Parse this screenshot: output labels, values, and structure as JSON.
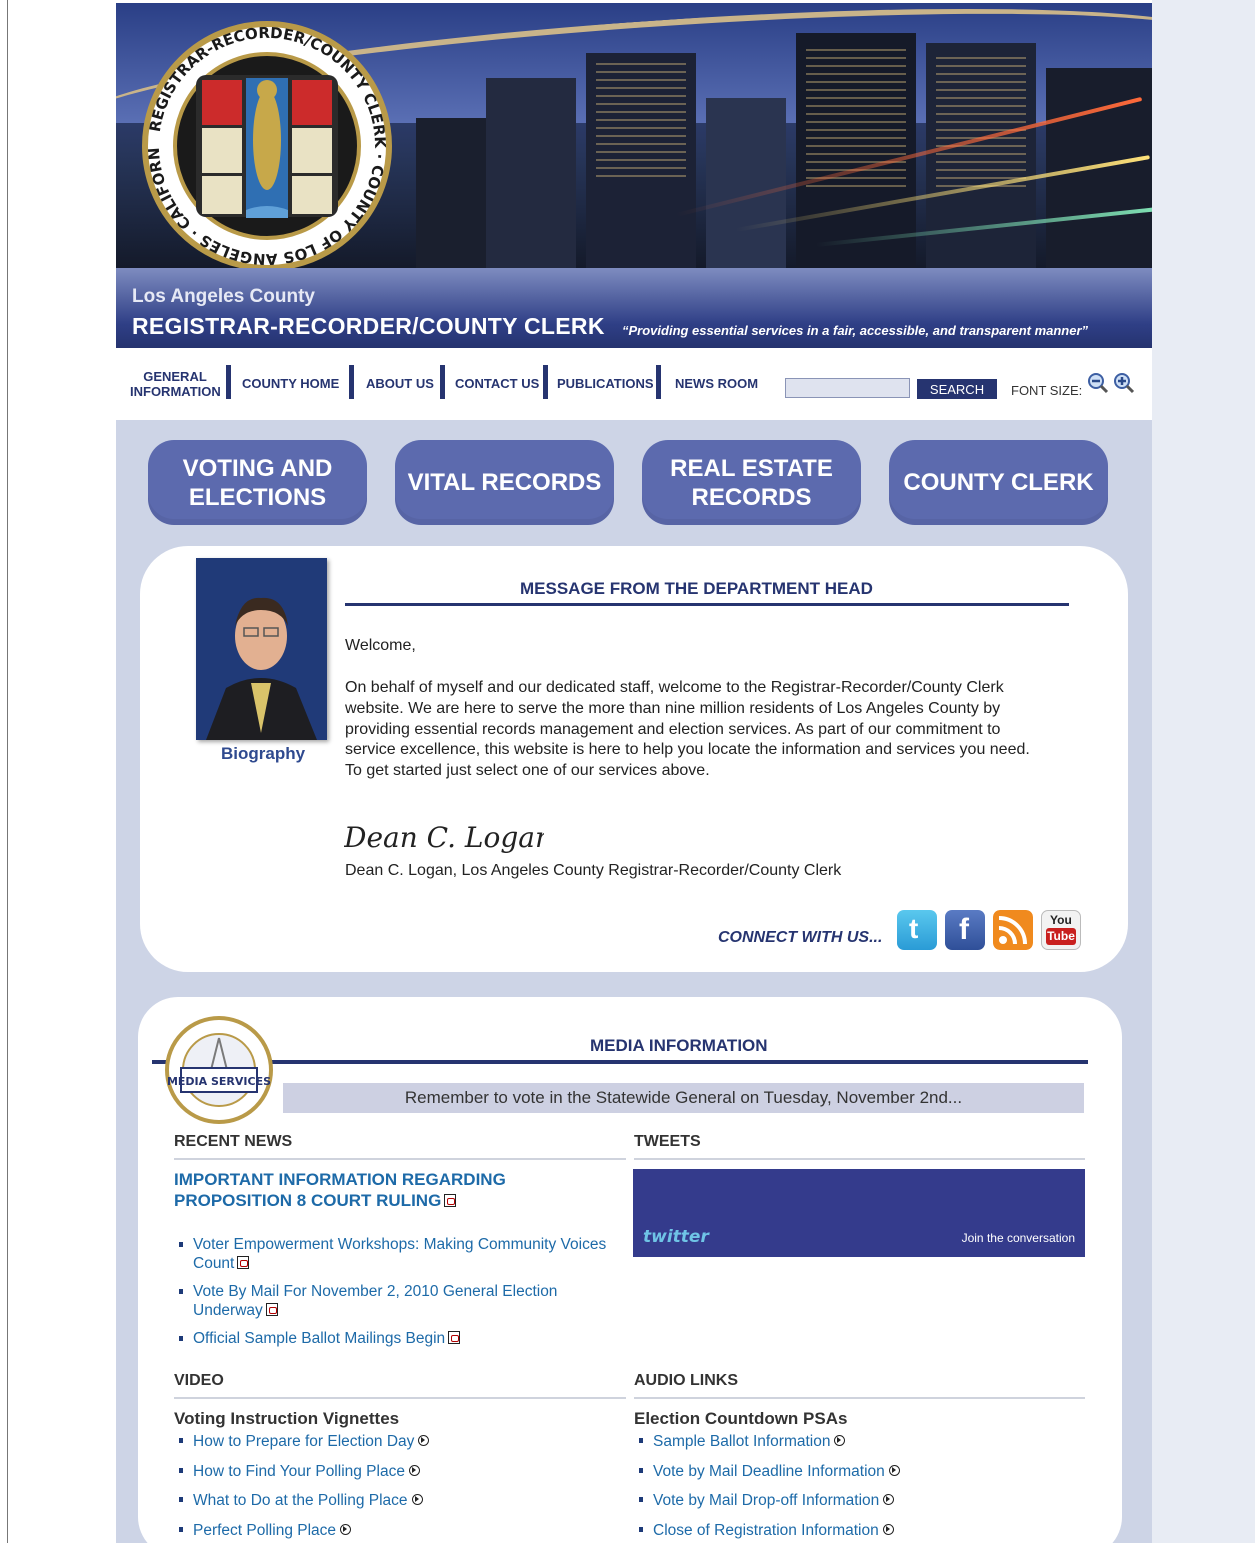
{
  "header": {
    "county": "Los Angeles County",
    "department": "REGISTRAR-RECORDER/COUNTY CLERK",
    "tagline": "“Providing essential services in a fair, accessible, and transparent manner”",
    "seal_text": "REGISTRAR-RECORDER/COUNTY CLERK · COUNTY OF LOS ANGELES · CALIFORNIA"
  },
  "nav": {
    "general_information": "GENERAL INFORMATION",
    "county_home": "COUNTY HOME",
    "about_us": "ABOUT US",
    "contact_us": "CONTACT US",
    "publications": "PUBLICATIONS",
    "news_room": "NEWS ROOM",
    "search_value": "",
    "search_button": "SEARCH",
    "font_size_label": "FONT SIZE:"
  },
  "services": [
    "VOTING AND ELECTIONS",
    "VITAL RECORDS",
    "REAL ESTATE RECORDS",
    "COUNTY CLERK"
  ],
  "message": {
    "heading": "MESSAGE FROM THE DEPARTMENT HEAD",
    "bio_link": "Biography",
    "greeting": "Welcome,",
    "body": "On behalf of myself and our dedicated staff, welcome to the Registrar-Recorder/County Clerk website. We are here to serve the more than nine million residents of Los Angeles County by providing essential records management and election services. As part of our commitment to service excellence, this website is here to help you locate the information and services you need. To get started just select one of our services above.",
    "signature": "Dean C. Logan",
    "signer": "Dean C. Logan, Los Angeles County Registrar-Recorder/County Clerk",
    "connect": "CONNECT WITH US..."
  },
  "social": {
    "twitter": "t",
    "facebook": "f",
    "youtube_top": "You",
    "youtube_bottom": "Tube"
  },
  "media": {
    "heading": "MEDIA INFORMATION",
    "seal_label": "MEDIA SERVICES",
    "ticker": "Remember to vote in the Statewide General on Tuesday, November 2nd...",
    "recent_news_heading": "RECENT NEWS",
    "headline": "IMPORTANT INFORMATION REGARDING PROPOSITION 8 COURT RULING",
    "news": [
      "Voter Empowerment Workshops: Making Community Voices Count",
      "Vote By Mail For November 2, 2010 General Election Underway",
      "Official Sample Ballot Mailings Begin"
    ],
    "tweets_heading": "TWEETS",
    "twitter_logo": "twitter",
    "twitter_join": "Join the conversation",
    "video_heading": "VIDEO",
    "video_subheading": "Voting Instruction Vignettes",
    "videos": [
      "How to Prepare for Election Day",
      "How to Find Your Polling Place",
      "What to Do at the Polling Place",
      "Perfect Polling Place"
    ],
    "audio_heading": "AUDIO LINKS",
    "audio_subheading": "Election Countdown PSAs",
    "audio": [
      "Sample Ballot Information",
      "Vote by Mail Deadline Information",
      "Vote by Mail Drop-off Information",
      "Close of Registration Information"
    ]
  },
  "colors": {
    "navy": "#263470",
    "service_button": "#5c6aae",
    "link": "#1d6aa8",
    "page_bg": "#cdd4e6"
  }
}
